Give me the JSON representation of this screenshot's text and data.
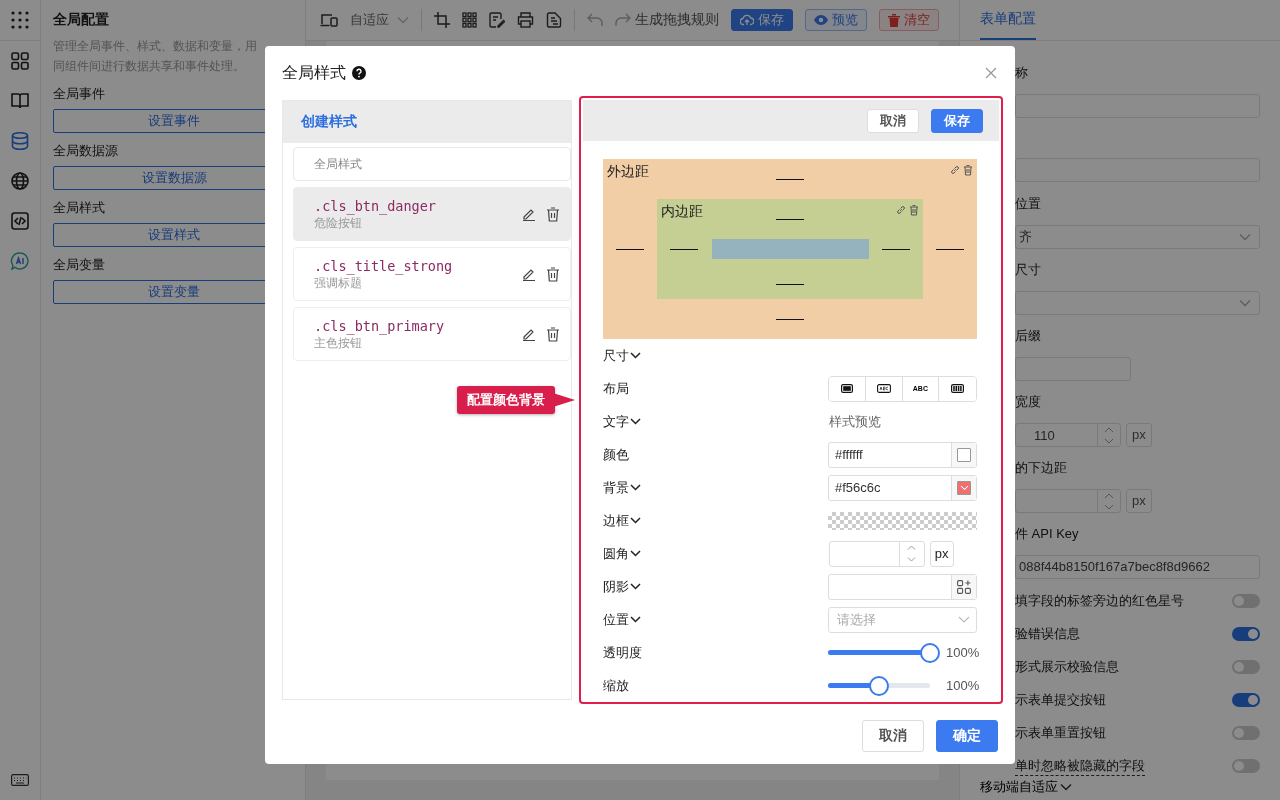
{
  "rail": {
    "items": [
      {
        "selected": false
      },
      {
        "selected": false
      },
      {
        "selected": true
      },
      {
        "selected": false
      },
      {
        "selected": false
      },
      {
        "selected": false
      }
    ]
  },
  "left_panel": {
    "title": "全局配置",
    "description": [
      "管理全局事件、样式、数据和变量，用",
      "同组件间进行数据共享和事件处理。"
    ],
    "sections": [
      {
        "label": "全局事件",
        "button": "设置事件"
      },
      {
        "label": "全局数据源",
        "button": "设置数据源"
      },
      {
        "label": "全局样式",
        "button": "设置样式"
      },
      {
        "label": "全局变量",
        "button": "设置变量"
      }
    ]
  },
  "toolbar": {
    "device": "自适应",
    "action": "生成拖拽规则",
    "buttons": [
      {
        "label": "保存",
        "kind": "primary"
      },
      {
        "label": "预览",
        "kind": "outline"
      },
      {
        "label": "清空",
        "kind": "danger"
      }
    ]
  },
  "right_panel": {
    "tab": {
      "label": "表单配置",
      "selected": true
    },
    "fields": [
      {
        "kind": "label",
        "text": "称"
      },
      {
        "kind": "input"
      },
      {
        "kind": "input"
      },
      {
        "kind": "label",
        "text": "位置"
      },
      {
        "kind": "select",
        "value": "齐"
      },
      {
        "kind": "label",
        "text": "尺寸"
      },
      {
        "kind": "select"
      },
      {
        "kind": "label",
        "text": "后缀"
      },
      {
        "kind": "input-short"
      },
      {
        "kind": "label",
        "text": "宽度"
      },
      {
        "kind": "number",
        "value": "110",
        "unit": "px"
      },
      {
        "kind": "label",
        "text": "的下边距"
      },
      {
        "kind": "number",
        "unit": "px"
      },
      {
        "kind": "label",
        "text": "件 API Key"
      },
      {
        "kind": "input",
        "value": "088f44b8150f167a7bec8f8d9662"
      }
    ],
    "toggles": [
      {
        "label": "填字段的标签旁边的红色星号",
        "on": false,
        "tooltip": false
      },
      {
        "label": "验错误信息",
        "on": true,
        "tooltip": false
      },
      {
        "label": "形式展示校验信息",
        "on": false,
        "tooltip": false
      },
      {
        "label": "示表单提交按钮",
        "on": true,
        "tooltip": false
      },
      {
        "label": "示表单重置按钮",
        "on": false,
        "tooltip": false
      },
      {
        "label": "单时忽略被隐藏的字段",
        "on": false,
        "tooltip": true
      }
    ],
    "footer": "移动端自适应"
  },
  "modal": {
    "title": "全局样式",
    "styles": {
      "create": "创建样式",
      "search_placeholder": "全局样式",
      "items": [
        {
          "name": ".cls_btn_danger",
          "description": "危险按钮",
          "selected": true
        },
        {
          "name": ".cls_title_strong",
          "description": "强调标题",
          "selected": false
        },
        {
          "name": ".cls_btn_primary",
          "description": "主色按钮",
          "selected": false
        }
      ]
    },
    "editor": {
      "cancel": "取消",
      "save": "保存",
      "margin_label": "外边距",
      "padding_label": "内边距",
      "rows": [
        {
          "label": "尺寸",
          "collapsible": true,
          "kind": "none"
        },
        {
          "label": "布局",
          "collapsible": false,
          "kind": "segmented",
          "options": [
            {
              "kind": "block"
            },
            {
              "kind": "inline-block"
            },
            {
              "kind": "inline",
              "text": "ABC"
            },
            {
              "kind": "flex"
            }
          ]
        },
        {
          "label": "文字",
          "collapsible": true,
          "kind": "text",
          "value": "样式预览"
        },
        {
          "label": "颜色",
          "collapsible": false,
          "kind": "color",
          "value": "#ffffff",
          "caret": false
        },
        {
          "label": "背景",
          "collapsible": true,
          "kind": "color",
          "value": "#f56c6c",
          "caret": true
        },
        {
          "label": "边框",
          "collapsible": true,
          "kind": "border"
        },
        {
          "label": "圆角",
          "collapsible": true,
          "kind": "number",
          "unit": "px"
        },
        {
          "label": "阴影",
          "collapsible": true,
          "kind": "shadow"
        },
        {
          "label": "位置",
          "collapsible": true,
          "kind": "select",
          "placeholder": "请选择"
        },
        {
          "label": "透明度",
          "collapsible": false,
          "kind": "slider",
          "level": 1,
          "reading": "100%"
        },
        {
          "label": "缩放",
          "collapsible": false,
          "kind": "slider",
          "level": 0.5,
          "reading": "100%"
        }
      ]
    },
    "footer": {
      "cancel": "取消",
      "ok": "确定"
    }
  },
  "callout": "配置颜色背景"
}
